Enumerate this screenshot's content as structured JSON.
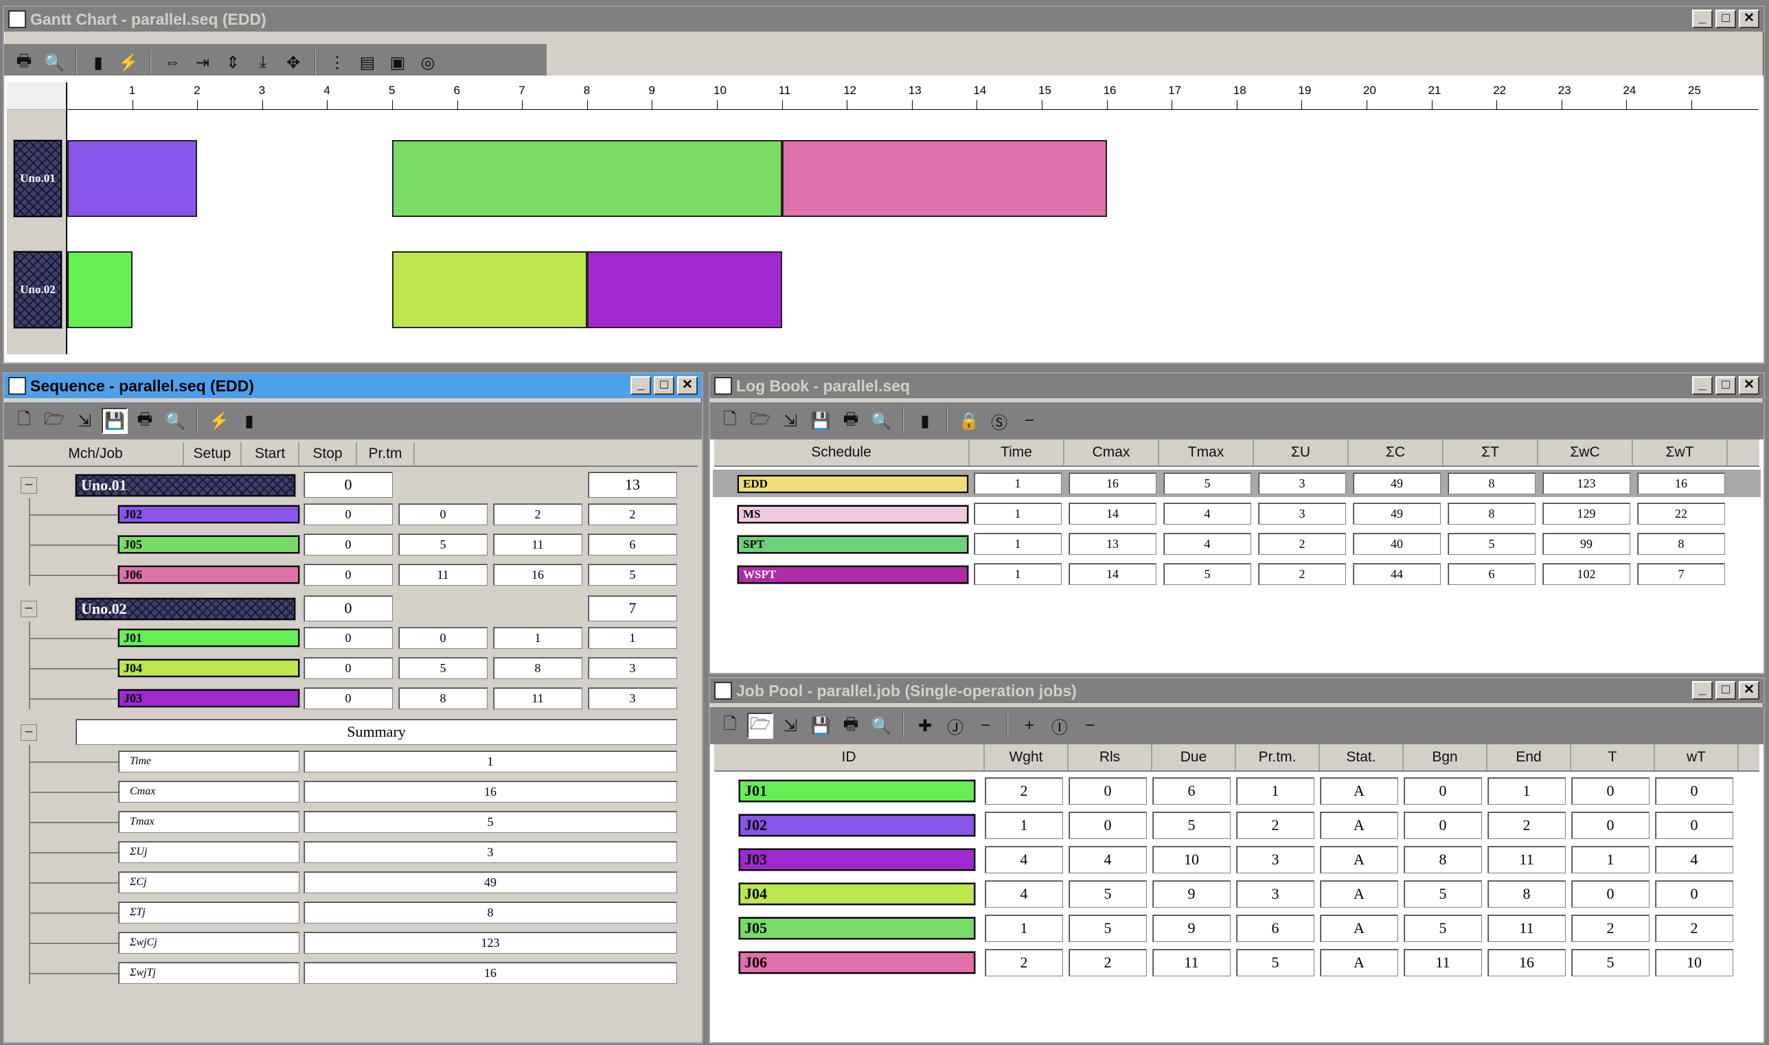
{
  "gantt": {
    "title": "Gantt Chart - parallel.seq (EDD)",
    "axis_ticks": [
      "1",
      "2",
      "3",
      "4",
      "5",
      "6",
      "7",
      "8",
      "9",
      "10",
      "11",
      "12",
      "13",
      "14",
      "15",
      "16",
      "17",
      "18",
      "19",
      "20",
      "21",
      "22",
      "23",
      "24",
      "25"
    ],
    "machines": [
      "Uno.01",
      "Uno.02"
    ],
    "chart_data": {
      "type": "gantt",
      "x_range": [
        0,
        25
      ],
      "rows": [
        {
          "machine": "Uno.01",
          "bars": [
            {
              "start": 0,
              "stop": 2,
              "color": "#8855e8"
            },
            {
              "start": 5,
              "stop": 11,
              "color": "#78dc66"
            },
            {
              "start": 11,
              "stop": 16,
              "color": "#e070aa"
            }
          ]
        },
        {
          "machine": "Uno.02",
          "bars": [
            {
              "start": 0,
              "stop": 1,
              "color": "#66ee55"
            },
            {
              "start": 5,
              "stop": 8,
              "color": "#bce64e"
            },
            {
              "start": 8,
              "stop": 11,
              "color": "#a028d0"
            }
          ]
        }
      ]
    }
  },
  "sequence": {
    "title": "Sequence - parallel.seq (EDD)",
    "headers": [
      "Mch/Job",
      "Setup",
      "Start",
      "Stop",
      "Pr.tm"
    ],
    "machines": [
      {
        "name": "Uno.01",
        "setup": "0",
        "prtm": "13",
        "jobs": [
          {
            "id": "J02",
            "color": "#8855e8",
            "setup": "0",
            "start": "0",
            "stop": "2",
            "prtm": "2"
          },
          {
            "id": "J05",
            "color": "#78dc66",
            "setup": "0",
            "start": "5",
            "stop": "11",
            "prtm": "6"
          },
          {
            "id": "J06",
            "color": "#e070aa",
            "setup": "0",
            "start": "11",
            "stop": "16",
            "prtm": "5"
          }
        ]
      },
      {
        "name": "Uno.02",
        "setup": "0",
        "prtm": "7",
        "jobs": [
          {
            "id": "J01",
            "color": "#66ee55",
            "setup": "0",
            "start": "0",
            "stop": "1",
            "prtm": "1"
          },
          {
            "id": "J04",
            "color": "#bce64e",
            "setup": "0",
            "start": "5",
            "stop": "8",
            "prtm": "3"
          },
          {
            "id": "J03",
            "color": "#a028d0",
            "setup": "0",
            "start": "8",
            "stop": "11",
            "prtm": "3"
          }
        ]
      }
    ],
    "summary_label": "Summary",
    "summary": [
      {
        "label": "Time",
        "value": "1"
      },
      {
        "label": "Cmax",
        "value": "16"
      },
      {
        "label": "Tmax",
        "value": "5"
      },
      {
        "label": "ΣUj",
        "value": "3"
      },
      {
        "label": "ΣCj",
        "value": "49"
      },
      {
        "label": "ΣTj",
        "value": "8"
      },
      {
        "label": "ΣwjCj",
        "value": "123"
      },
      {
        "label": "ΣwjTj",
        "value": "16"
      }
    ]
  },
  "logbook": {
    "title": "Log Book - parallel.seq",
    "headers": [
      "Schedule",
      "Time",
      "Cmax",
      "Tmax",
      "ΣU",
      "ΣC",
      "ΣT",
      "ΣwC",
      "ΣwT"
    ],
    "rows": [
      {
        "name": "EDD",
        "color": "#f0dc78",
        "cells": [
          "1",
          "16",
          "5",
          "3",
          "49",
          "8",
          "123",
          "16"
        ],
        "selected": true
      },
      {
        "name": "MS",
        "color": "#f0c8e0",
        "cells": [
          "1",
          "14",
          "4",
          "3",
          "49",
          "8",
          "129",
          "22"
        ]
      },
      {
        "name": "SPT",
        "color": "#6cd27c",
        "cells": [
          "1",
          "13",
          "4",
          "2",
          "40",
          "5",
          "99",
          "8"
        ]
      },
      {
        "name": "WSPT",
        "color": "#b02aa8",
        "cells": [
          "1",
          "14",
          "5",
          "2",
          "44",
          "6",
          "102",
          "7"
        ]
      }
    ]
  },
  "jobpool": {
    "title": "Job Pool - parallel.job (Single-operation jobs)",
    "headers": [
      "ID",
      "Wght",
      "Rls",
      "Due",
      "Pr.tm.",
      "Stat.",
      "Bgn",
      "End",
      "T",
      "wT"
    ],
    "rows": [
      {
        "id": "J01",
        "color": "#66ee55",
        "cells": [
          "2",
          "0",
          "6",
          "1",
          "A",
          "0",
          "1",
          "0",
          "0"
        ]
      },
      {
        "id": "J02",
        "color": "#8855e8",
        "cells": [
          "1",
          "0",
          "5",
          "2",
          "A",
          "0",
          "2",
          "0",
          "0"
        ]
      },
      {
        "id": "J03",
        "color": "#a028d0",
        "cells": [
          "4",
          "4",
          "10",
          "3",
          "A",
          "8",
          "11",
          "1",
          "4"
        ]
      },
      {
        "id": "J04",
        "color": "#bce64e",
        "cells": [
          "4",
          "5",
          "9",
          "3",
          "A",
          "5",
          "8",
          "0",
          "0"
        ]
      },
      {
        "id": "J05",
        "color": "#78dc66",
        "cells": [
          "1",
          "5",
          "9",
          "6",
          "A",
          "5",
          "11",
          "2",
          "2"
        ]
      },
      {
        "id": "J06",
        "color": "#e070aa",
        "cells": [
          "2",
          "2",
          "11",
          "5",
          "A",
          "11",
          "16",
          "5",
          "10"
        ]
      }
    ]
  }
}
